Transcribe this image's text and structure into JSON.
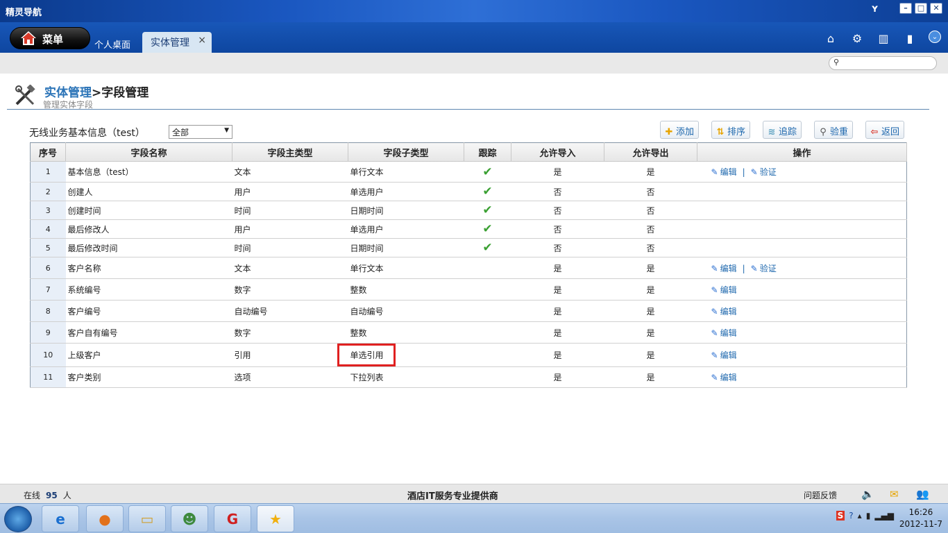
{
  "window": {
    "title": "精灵导航"
  },
  "tabbar": {
    "menu_label": "菜单",
    "tabs": [
      {
        "label": "个人桌面"
      },
      {
        "label": "实体管理"
      }
    ],
    "close_glyph": "×"
  },
  "header": {
    "breadcrumb_link": "实体管理",
    "breadcrumb_sep": ">",
    "breadcrumb_current": "字段管理",
    "subtitle": "管理实体字段"
  },
  "toolbar": {
    "entity_label": "无线业务基本信息（test）",
    "filter_value": "全部",
    "buttons": {
      "add": "添加",
      "sort": "排序",
      "track": "追踪",
      "verify": "验重",
      "back": "返回"
    }
  },
  "table": {
    "headers": [
      "序号",
      "字段名称",
      "字段主类型",
      "字段子类型",
      "跟踪",
      "允许导入",
      "允许导出",
      "操作"
    ],
    "edit_label": "编辑",
    "validate_label": "验证",
    "op_sep": "|",
    "rows": [
      {
        "idx": "1",
        "name": "基本信息（test）",
        "main": "文本",
        "sub": "单行文本",
        "track": true,
        "import": "是",
        "export": "是",
        "edit": true,
        "validate": true
      },
      {
        "idx": "2",
        "name": "创建人",
        "main": "用户",
        "sub": "单选用户",
        "track": true,
        "import": "否",
        "export": "否",
        "edit": false,
        "validate": false
      },
      {
        "idx": "3",
        "name": "创建时间",
        "main": "时间",
        "sub": "日期时间",
        "track": true,
        "import": "否",
        "export": "否",
        "edit": false,
        "validate": false
      },
      {
        "idx": "4",
        "name": "最后修改人",
        "main": "用户",
        "sub": "单选用户",
        "track": true,
        "import": "否",
        "export": "否",
        "edit": false,
        "validate": false
      },
      {
        "idx": "5",
        "name": "最后修改时间",
        "main": "时间",
        "sub": "日期时间",
        "track": true,
        "import": "否",
        "export": "否",
        "edit": false,
        "validate": false
      },
      {
        "idx": "6",
        "name": "客户名称",
        "main": "文本",
        "sub": "单行文本",
        "track": false,
        "import": "是",
        "export": "是",
        "edit": true,
        "validate": true
      },
      {
        "idx": "7",
        "name": "系统编号",
        "main": "数字",
        "sub": "整数",
        "track": false,
        "import": "是",
        "export": "是",
        "edit": true,
        "validate": false
      },
      {
        "idx": "8",
        "name": "客户编号",
        "main": "自动编号",
        "sub": "自动编号",
        "track": false,
        "import": "是",
        "export": "是",
        "edit": true,
        "validate": false
      },
      {
        "idx": "9",
        "name": "客户自有编号",
        "main": "数字",
        "sub": "整数",
        "track": false,
        "import": "是",
        "export": "是",
        "edit": true,
        "validate": false
      },
      {
        "idx": "10",
        "name": "上级客户",
        "main": "引用",
        "sub": "单选引用",
        "track": false,
        "import": "是",
        "export": "是",
        "edit": true,
        "validate": false,
        "highlight_sub": true
      },
      {
        "idx": "11",
        "name": "客户类别",
        "main": "选项",
        "sub": "下拉列表",
        "track": false,
        "import": "是",
        "export": "是",
        "edit": true,
        "validate": false
      }
    ]
  },
  "status": {
    "online_prefix": "在线",
    "online_count": "95",
    "online_suffix": "人",
    "slogan": "酒店IT服务专业提供商",
    "feedback": "问题反馈"
  },
  "taskbar": {
    "time": "16:26",
    "date": "2012-11-7"
  },
  "colors": {
    "accent": "#2a73b7",
    "titlebar": "#1a57c0",
    "check": "#3aa032",
    "highlight": "#e02020"
  }
}
